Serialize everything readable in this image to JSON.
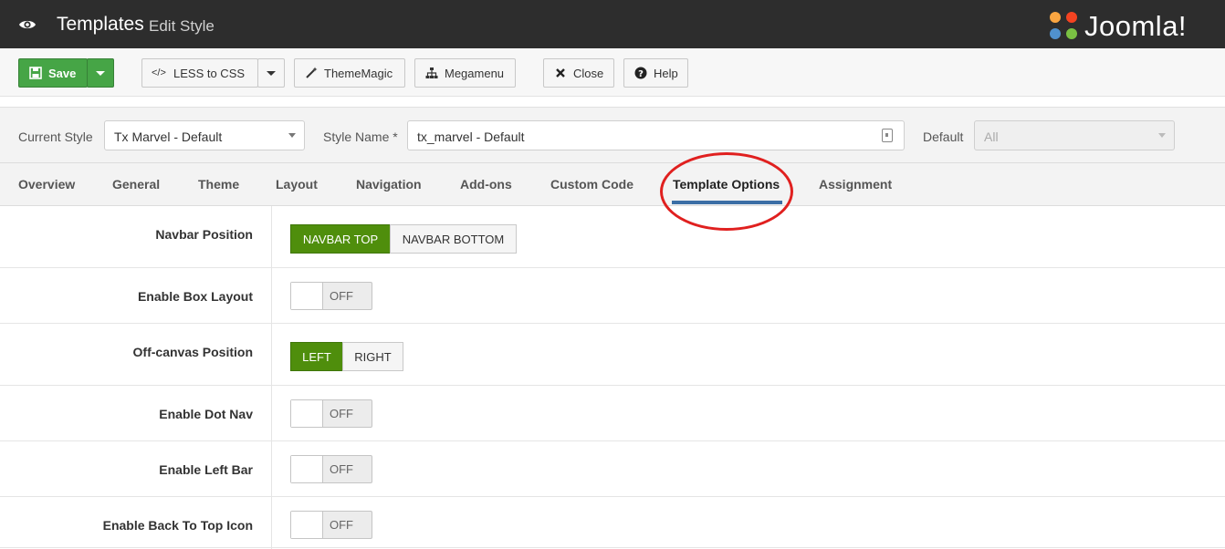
{
  "header": {
    "title": "Templates",
    "subtitle": "Edit Style",
    "logo_text": "Joomla!",
    "icon": "eye-icon"
  },
  "toolbar": {
    "save_label": "Save",
    "less_label": "LESS to CSS",
    "thememagic_label": "ThemeMagic",
    "megamenu_label": "Megamenu",
    "close_label": "Close",
    "help_label": "Help",
    "icons": [
      "save-icon",
      "code-icon",
      "wand-icon",
      "sitemap-icon",
      "close-icon",
      "question-icon"
    ]
  },
  "stylebar": {
    "current_style_label": "Current Style",
    "current_style_value": "Tx Marvel - Default",
    "style_name_label": "Style Name *",
    "style_name_value": "tx_marvel - Default",
    "default_label": "Default",
    "default_value": "All"
  },
  "tabs": [
    {
      "label": "Overview"
    },
    {
      "label": "General"
    },
    {
      "label": "Theme"
    },
    {
      "label": "Layout"
    },
    {
      "label": "Navigation"
    },
    {
      "label": "Add-ons"
    },
    {
      "label": "Custom Code"
    },
    {
      "label": "Template Options"
    },
    {
      "label": "Assignment"
    }
  ],
  "active_tab": "Template Options",
  "form": {
    "navbar_position": {
      "label": "Navbar Position",
      "options": [
        "NAVBAR TOP",
        "NAVBAR BOTTOM"
      ],
      "selected": "NAVBAR TOP"
    },
    "box_layout": {
      "label": "Enable Box Layout",
      "state": "OFF"
    },
    "offcanvas_position": {
      "label": "Off-canvas Position",
      "options": [
        "LEFT",
        "RIGHT"
      ],
      "selected": "LEFT"
    },
    "dot_nav": {
      "label": "Enable Dot Nav",
      "state": "OFF"
    },
    "left_bar": {
      "label": "Enable Left Bar",
      "state": "OFF"
    },
    "back_to_top": {
      "label": "Enable Back To Top Icon",
      "state": "OFF"
    }
  },
  "colors": {
    "header_bg": "#2d2d2d",
    "save_green": "#46a546",
    "active_segment": "#4f8e0c",
    "tab_underline": "#3b6ea5",
    "highlight_ring": "#e0201f"
  }
}
